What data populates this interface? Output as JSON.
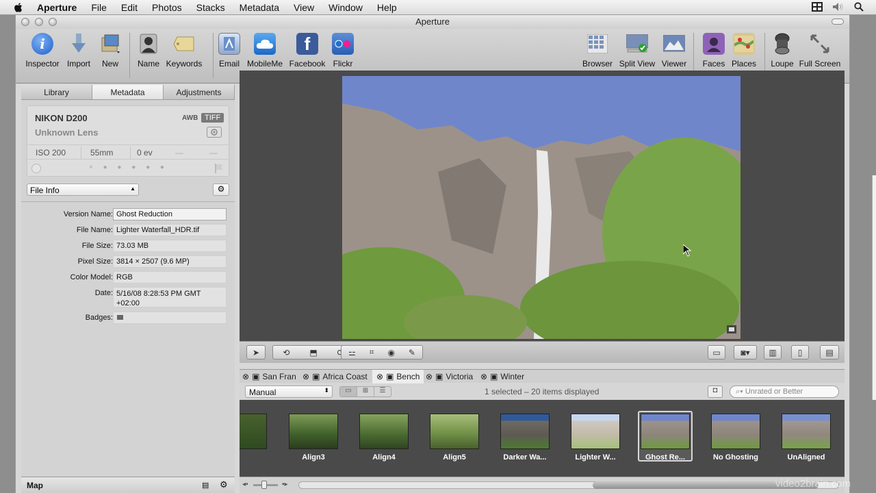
{
  "menubar": {
    "app": "Aperture",
    "items": [
      "File",
      "Edit",
      "Photos",
      "Stacks",
      "Metadata",
      "View",
      "Window",
      "Help"
    ]
  },
  "window": {
    "title": "Aperture"
  },
  "toolbar": {
    "inspector": "Inspector",
    "import": "Import",
    "new": "New",
    "name": "Name",
    "keywords": "Keywords",
    "email": "Email",
    "mobileme": "MobileMe",
    "facebook": "Facebook",
    "flickr": "Flickr",
    "browser": "Browser",
    "split_view": "Split View",
    "viewer": "Viewer",
    "faces": "Faces",
    "places": "Places",
    "loupe": "Loupe",
    "full_screen": "Full Screen"
  },
  "tabs": {
    "library": "Library",
    "metadata": "Metadata",
    "adjustments": "Adjustments"
  },
  "camera": {
    "model": "NIKON D200",
    "lens": "Unknown Lens",
    "wb": "AWB",
    "format": "TIFF",
    "iso": "ISO 200",
    "focal": "55mm",
    "ev": "0 ev",
    "dash1": "—",
    "dash2": "—"
  },
  "view_select": {
    "value": "File Info"
  },
  "file_info": [
    {
      "label": "Version Name:",
      "value": "Ghost Reduction"
    },
    {
      "label": "File Name:",
      "value": "Lighter Waterfall_HDR.tif"
    },
    {
      "label": "File Size:",
      "value": "73.03 MB"
    },
    {
      "label": "Pixel Size:",
      "value": "3814 × 2507 (9.6 MP)"
    },
    {
      "label": "Color Model:",
      "value": "RGB"
    },
    {
      "label": "Date:",
      "value": "5/16/08 8:28:53 PM GMT +02:00"
    },
    {
      "label": "Badges:",
      "value": ""
    }
  ],
  "projects": [
    "San Fran",
    "Africa Coast",
    "Bench",
    "Victoria",
    "Winter"
  ],
  "browser": {
    "sort": "Manual",
    "status": "1 selected – 20 items displayed",
    "filter_placeholder": "Unrated or Better"
  },
  "thumbs": [
    "Align3",
    "Align4",
    "Align5",
    "Darker Wa...",
    "Lighter W...",
    "Ghost Re...",
    "No Ghosting",
    "UnAligned"
  ],
  "status": {
    "map": "Map"
  },
  "watermark": "video2brain.com",
  "colors": {
    "sky": "#6f86cb",
    "rock": "#9a9088",
    "foliage": "#7aa44a"
  }
}
